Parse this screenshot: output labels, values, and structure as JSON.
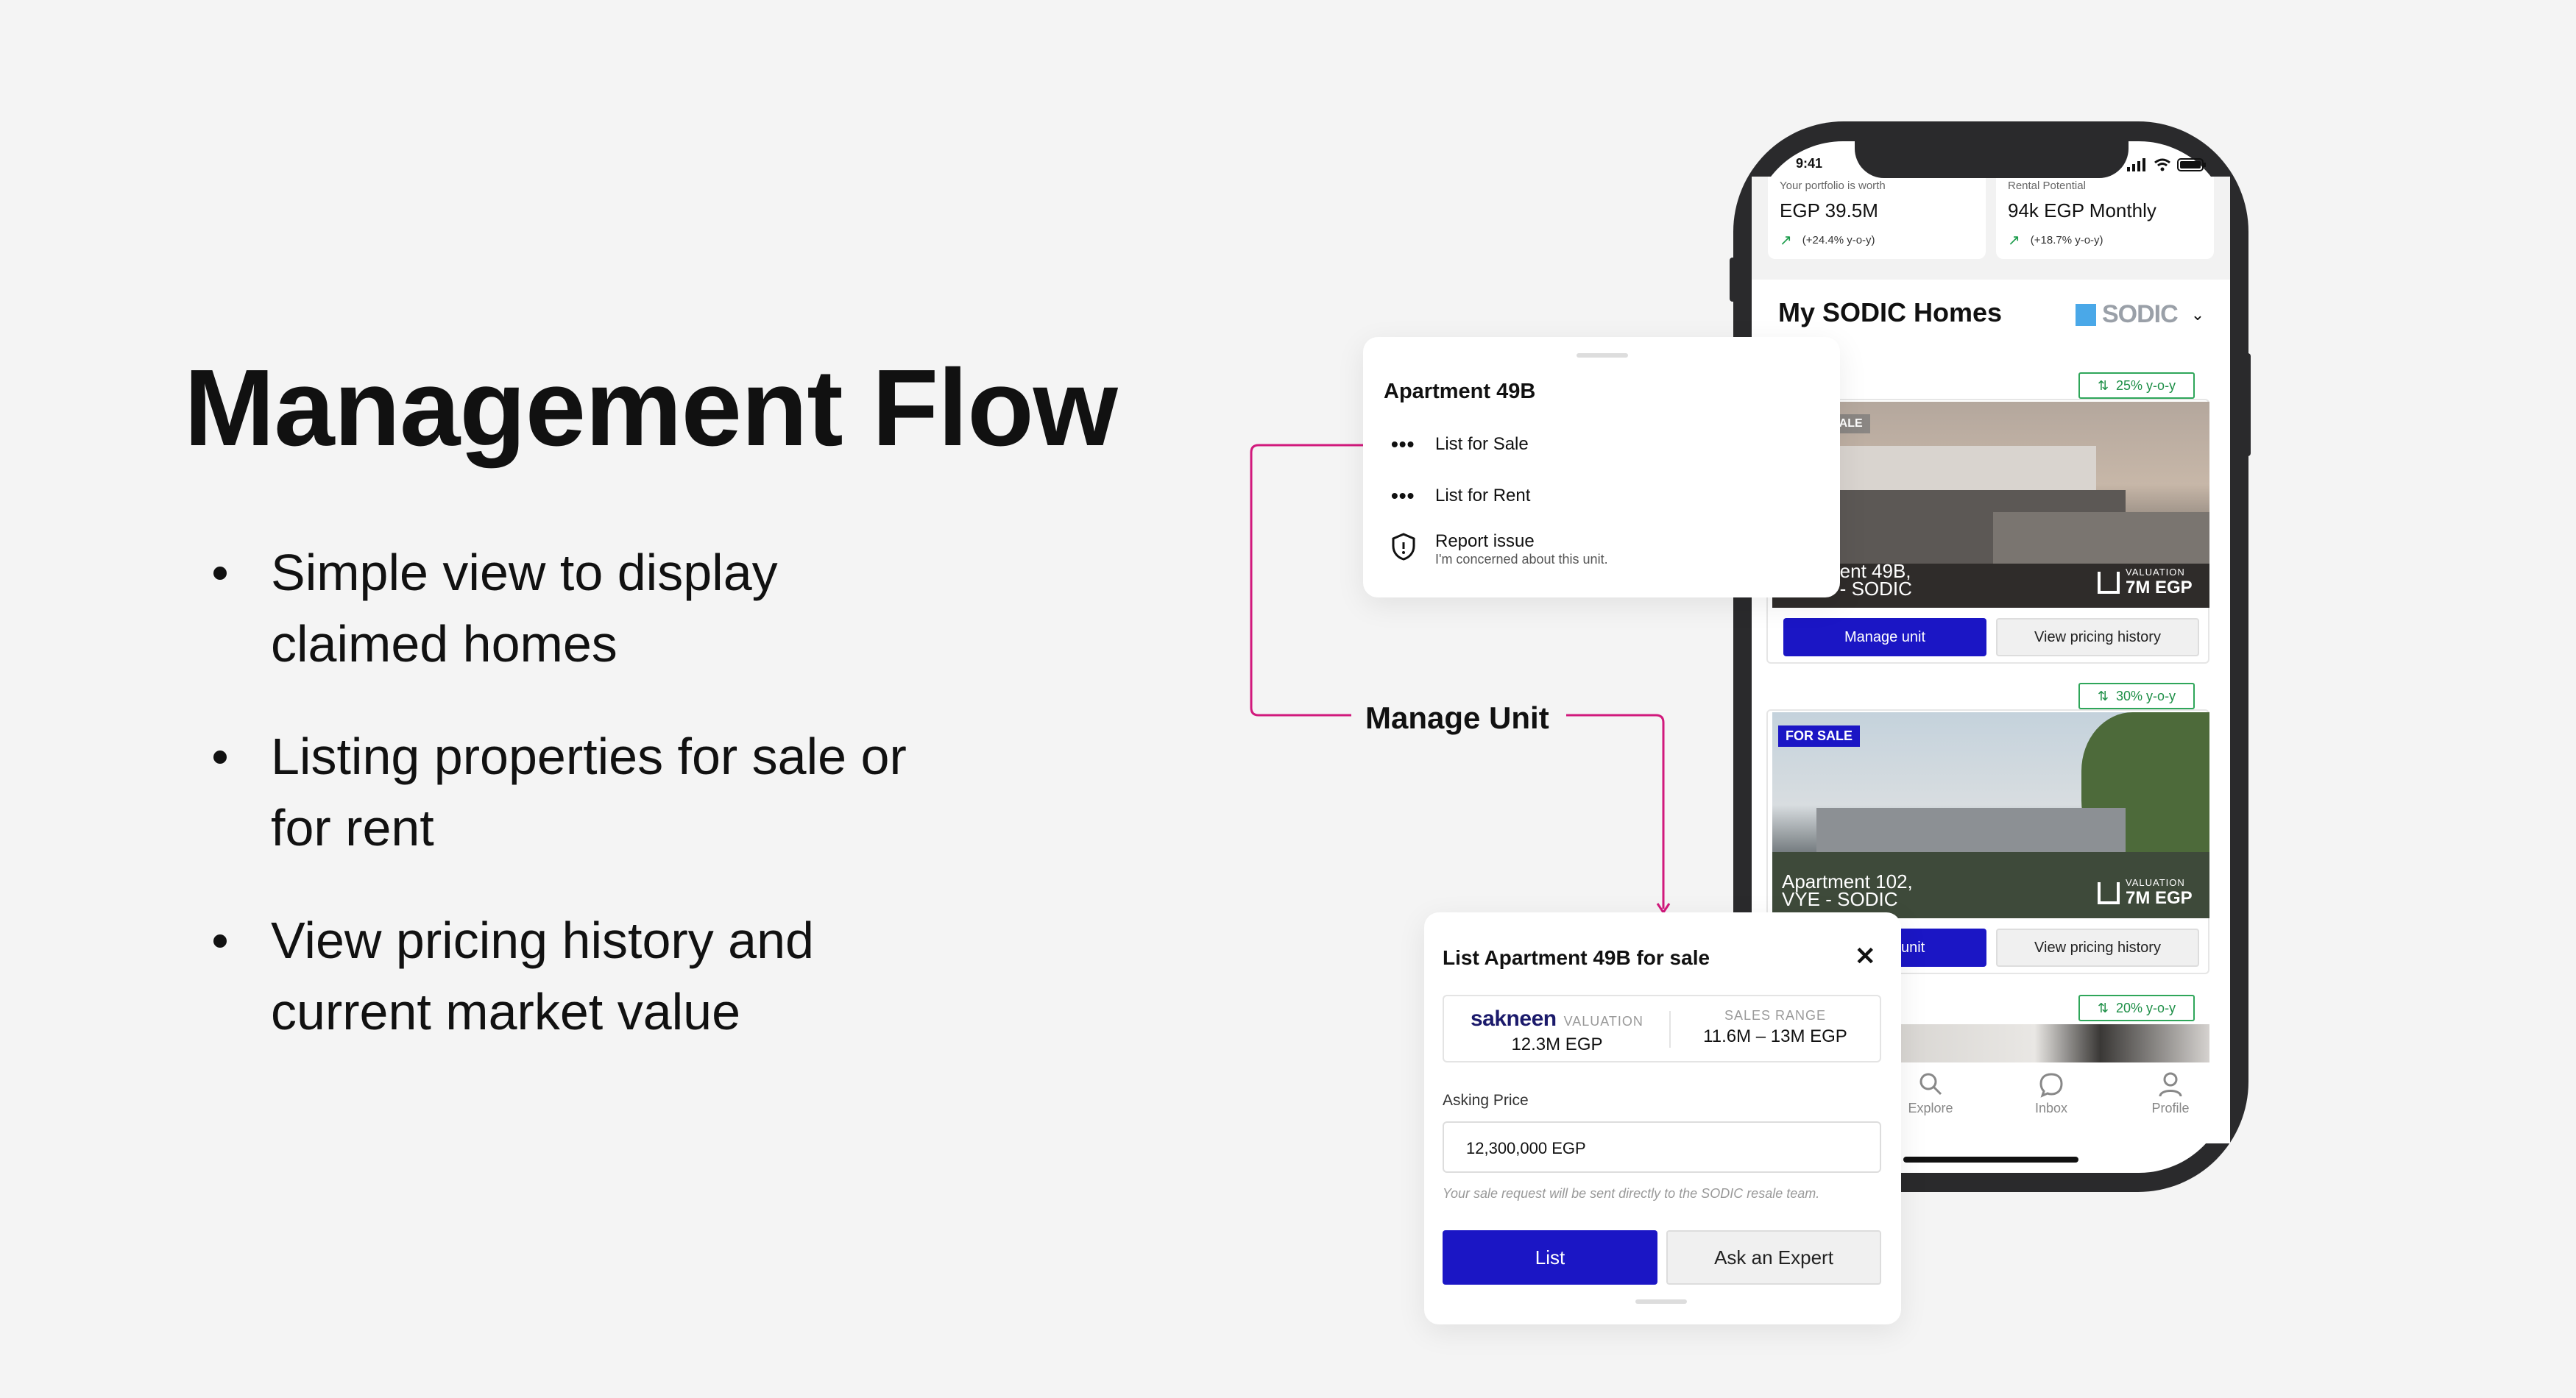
{
  "heading": "Management Flow",
  "bullets": [
    {
      "line1": "Simple view to display",
      "line2": "claimed homes"
    },
    {
      "line1": "Listing properties for sale or",
      "line2": "for rent"
    },
    {
      "line1": "View pricing history and",
      "line2": "current market value"
    }
  ],
  "phone": {
    "time": "9:41",
    "portfolio": {
      "label": "Your portfolio is worth",
      "value": "EGP 39.5M",
      "trend": "(+24.4% y-o-y)"
    },
    "rental": {
      "label": "Rental Potential",
      "value": "94k EGP Monthly",
      "trend": "(+18.7% y-o-y)"
    },
    "section_title": "My SODIC Homes",
    "brand": "SODIC",
    "homes": [
      {
        "growth": "25% y-o-y",
        "badge": "SALE",
        "name_line1": "ment 49B,",
        "name_line2": "e - SODIC",
        "valuation_label": "VALUATION",
        "valuation": "7M EGP",
        "manage_label": "Manage unit",
        "history_label": "View pricing history"
      },
      {
        "growth": "30% y-o-y",
        "badge": "FOR SALE",
        "name_line1": "Apartment 102,",
        "name_line2": "VYE - SODIC",
        "valuation_label": "VALUATION",
        "valuation": "7M EGP",
        "manage_label": "unit",
        "history_label": "View pricing history"
      },
      {
        "growth": "20% y-o-y"
      }
    ],
    "tabs": [
      {
        "label": "Explore",
        "icon": "search-icon"
      },
      {
        "label": "Inbox",
        "icon": "chat-icon"
      },
      {
        "label": "Profile",
        "icon": "user-icon"
      }
    ]
  },
  "manage_menu": {
    "title": "Apartment 49B",
    "items": [
      {
        "label": "List for Sale"
      },
      {
        "label": "List for Rent"
      },
      {
        "label": "Report issue",
        "sub": "I'm concerned about this unit."
      }
    ]
  },
  "connector_label": "Manage Unit",
  "list_sheet": {
    "title": "List Apartment 49B for sale",
    "close": "✕",
    "valuation_brand": "sakneen",
    "valuation_label": "VALUATION",
    "valuation_value": "12.3M EGP",
    "range_label": "SALES RANGE",
    "range_value": "11.6M – 13M EGP",
    "asking_label": "Asking Price",
    "asking_value": "12,300,000 EGP",
    "hint": "Your sale request will be sent directly to the SODIC resale team.",
    "primary_button": "List",
    "secondary_button": "Ask an Expert"
  },
  "colors": {
    "accent": "#1b16c5",
    "connector": "#d1197c",
    "growth": "#2fa65a"
  }
}
